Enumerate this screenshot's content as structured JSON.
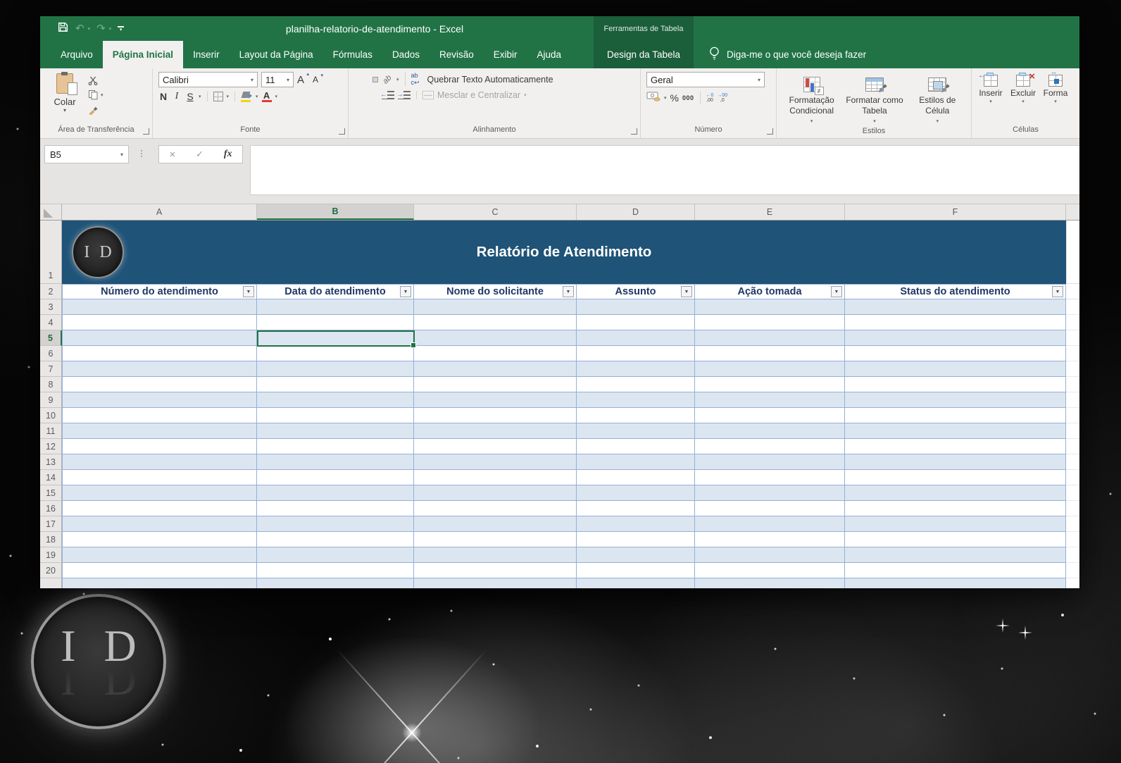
{
  "colors": {
    "green": "#217346",
    "ctx": "#1b5e3a",
    "banner": "#1f5377",
    "band": "#dce6f1",
    "tblue": "#94b0d7",
    "htext": "#1f3864",
    "ribbon": "#f1f0ee"
  },
  "titlebar": {
    "title": "planilha-relatorio-de-atendimento  -  Excel",
    "contextual_group": "Ferramentas de Tabela"
  },
  "tabs": [
    {
      "label": "Arquivo"
    },
    {
      "label": "Página Inicial",
      "selected": true
    },
    {
      "label": "Inserir"
    },
    {
      "label": "Layout da Página"
    },
    {
      "label": "Fórmulas"
    },
    {
      "label": "Dados"
    },
    {
      "label": "Revisão"
    },
    {
      "label": "Exibir"
    },
    {
      "label": "Ajuda"
    },
    {
      "label": "Design da Tabela",
      "contextual": true
    }
  ],
  "tellme": "Diga-me o que você deseja fazer",
  "ribbon": {
    "clipboard": {
      "paste": "Colar",
      "group": "Área de Transferência"
    },
    "font": {
      "family": "Calibri",
      "size": "11",
      "bold": "N",
      "italic": "I",
      "underline": "S",
      "group": "Fonte"
    },
    "alignment": {
      "wrap": "Quebrar Texto Automaticamente",
      "merge": "Mesclar e Centralizar",
      "orientation": "ab",
      "group": "Alinhamento"
    },
    "number": {
      "format": "Geral",
      "percent": "%",
      "thousands": "000",
      "dec_inc": [
        "←0",
        ",00"
      ],
      "dec_dec": [
        "→00",
        ",0"
      ],
      "group": "Número"
    },
    "styles": {
      "conditional": "Formatação Condicional",
      "not_equal": "≠",
      "format_table": "Formatar como Tabela",
      "cell_styles": "Estilos de Célula",
      "group": "Estilos"
    },
    "cells": {
      "insert": "Inserir",
      "delete": "Excluir",
      "format": "Forma",
      "group": "Células"
    }
  },
  "formula": {
    "name_box": "B5",
    "cancel": "×",
    "enter": "✓",
    "fx": "fx"
  },
  "sheet": {
    "columns": [
      "A",
      "B",
      "C",
      "D",
      "E",
      "F"
    ],
    "selected_column": "B",
    "selected_row": 5,
    "active_cell": "B5",
    "row_numbers": [
      1,
      2,
      3,
      4,
      5,
      6,
      7,
      8,
      9,
      10,
      11,
      12,
      13,
      14,
      15,
      16,
      17,
      18,
      19,
      20
    ],
    "banner": {
      "logo": "I D",
      "title": "Relatório de Atendimento"
    },
    "table_headers": [
      "Número do atendimento",
      "Data do atendimento",
      "Nome do solicitante",
      "Assunto",
      "Ação tomada",
      "Status do atendimento"
    ]
  },
  "watermark": {
    "logo": "I D"
  },
  "glyphs": {
    "undo": "↶",
    "redo": "↷",
    "dropdown": "▾",
    "filter": "▼"
  }
}
